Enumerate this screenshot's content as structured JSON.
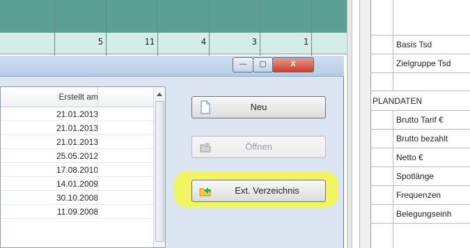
{
  "sheet": {
    "numbers": [
      "5",
      "11",
      "4",
      "3",
      "1"
    ]
  },
  "right_panel": {
    "rows": [
      {
        "label": "Basis Tsd"
      },
      {
        "label": "Zielgruppe Tsd"
      },
      {
        "label": ""
      },
      {
        "label": "PLANDATEN"
      },
      {
        "label": "Brutto Tarif €"
      },
      {
        "label": "Brutto bezahlt"
      },
      {
        "label": "Netto €"
      },
      {
        "label": "Spotlänge"
      },
      {
        "label": "Frequenzen"
      },
      {
        "label": "Belegungseinh"
      }
    ]
  },
  "dialog": {
    "titlebar_buttons": {
      "minimize": "—",
      "maximize": "▢",
      "close": "X"
    },
    "list": {
      "header": "Erstellt am",
      "rows": [
        "21.01.2013",
        "21.01.2013",
        "21.01.2013",
        "25.05.2012",
        "17.08.2010",
        "14.01.2009",
        "30.10.2008",
        "11.09.2008"
      ]
    },
    "buttons": {
      "new": "Neu",
      "open": "Öffnen",
      "ext": "Ext. Verzeichnis"
    }
  },
  "colors": {
    "sheet_header": "#5b9f95",
    "sheet_row": "#d6ece6",
    "highlight": "#ffff00"
  }
}
